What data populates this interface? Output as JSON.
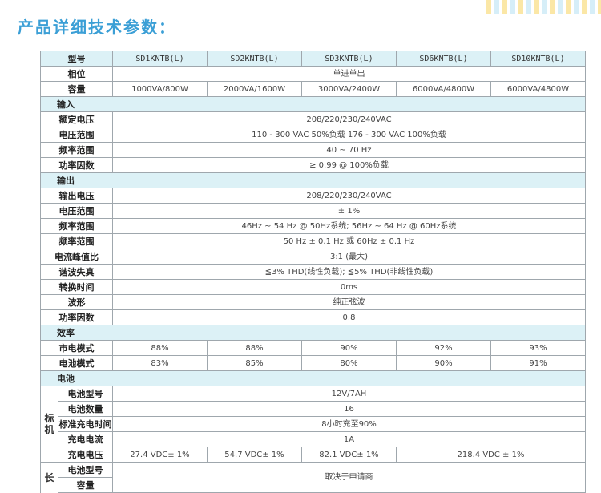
{
  "heading": "产品详细技术参数：",
  "deco_colors": [
    "#fbe7a6",
    "#d6eef8",
    "#fbe7a6",
    "#d6eef8",
    "#fbe7a6",
    "#d6eef8",
    "#fbe7a6",
    "#d6eef8",
    "#fbe7a6",
    "#d6eef8",
    "#fbe7a6",
    "#d6eef8",
    "#fbe7a6",
    "#d6eef8",
    "#fbe7a6"
  ],
  "colors": {
    "heading": "#3b9fd6",
    "section_bg": "#dcf1f6",
    "border": "#9fa7ad"
  },
  "table": {
    "header": {
      "label": "型号",
      "models": [
        "SD1KNTB(L)",
        "SD2KNTB(L)",
        "SD3KNTB(L)",
        "SD6KNTB(L)",
        "SD10KNTB(L)"
      ]
    },
    "phase": {
      "label": "相位",
      "value": "单进单出"
    },
    "capacity": {
      "label": "容量",
      "values": [
        "1000VA/800W",
        "2000VA/1600W",
        "3000VA/2400W",
        "6000VA/4800W",
        "6000VA/4800W"
      ]
    },
    "input": {
      "title": "输入",
      "rows": [
        {
          "label": "额定电压",
          "value": "208/220/230/240VAC"
        },
        {
          "label": "电压范围",
          "value": "110 - 300 VAC 50%负载  176 - 300 VAC 100%负载"
        },
        {
          "label": "频率范围",
          "value": "40 ~ 70 Hz"
        },
        {
          "label": "功率因数",
          "value": "≥ 0.99 @ 100%负载"
        }
      ]
    },
    "output": {
      "title": "输出",
      "rows": [
        {
          "label": "输出电压",
          "value": "208/220/230/240VAC"
        },
        {
          "label": "电压范围",
          "value": "± 1%"
        },
        {
          "label": "频率范围",
          "value": "46Hz ~ 54 Hz @ 50Hz系统; 56Hz ~ 64 Hz @ 60Hz系统"
        },
        {
          "label": "频率范围",
          "value": "50 Hz ± 0.1 Hz 或 60Hz ± 0.1 Hz"
        },
        {
          "label": "电流峰值比",
          "value": "3:1 (最大)"
        },
        {
          "label": "谐波失真",
          "value": "≦3% THD(线性负载); ≦5% THD(非线性负载)"
        },
        {
          "label": "转换时间",
          "value": "0ms"
        },
        {
          "label": "波形",
          "value": "纯正弦波"
        },
        {
          "label": "功率因数",
          "value": "0.8"
        }
      ]
    },
    "efficiency": {
      "title": "效率",
      "rows": [
        {
          "label": "市电模式",
          "values": [
            "88%",
            "88%",
            "90%",
            "92%",
            "93%"
          ]
        },
        {
          "label": "电池模式",
          "values": [
            "83%",
            "85%",
            "80%",
            "90%",
            "91%"
          ]
        }
      ]
    },
    "battery": {
      "title": "电池",
      "standard": {
        "group": "标机",
        "type": {
          "label": "电池型号",
          "value": "12V/7AH"
        },
        "count": {
          "label": "电池数量",
          "value": "16"
        },
        "charge_time": {
          "label": "标准充电时间",
          "value": "8小时充至90%"
        },
        "charge_current": {
          "label": "充电电流",
          "value": "1A"
        },
        "charge_voltage": {
          "label": "充电电压",
          "values": [
            "27.4 VDC± 1%",
            "54.7 VDC± 1%",
            "82.1 VDC± 1%",
            "218.4 VDC ± 1%"
          ]
        }
      },
      "long": {
        "group": "长",
        "type_label": "电池型号",
        "capacity_label": "容量",
        "value": "取决于申请商"
      }
    }
  }
}
